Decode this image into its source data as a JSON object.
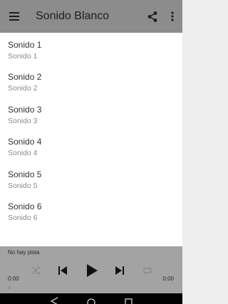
{
  "toolbar": {
    "title": "Sonido Blanco",
    "menu_icon": "hamburger-menu-icon",
    "share_icon": "share-icon",
    "overflow_icon": "more-vert-icon",
    "background": "#8c8c8c"
  },
  "list": {
    "items": [
      {
        "title": "Sonido 1",
        "subtitle": "Sonido 1"
      },
      {
        "title": "Sonido 2",
        "subtitle": "Sonido 2"
      },
      {
        "title": "Sonido 3",
        "subtitle": "Sonido 3"
      },
      {
        "title": "Sonido 4",
        "subtitle": "Sonido 4"
      },
      {
        "title": "Sonido 5",
        "subtitle": "Sonido 5"
      },
      {
        "title": "Sonido 6",
        "subtitle": "Sonido 6"
      }
    ]
  },
  "player": {
    "track_label": "No hay pista",
    "elapsed": "0:00",
    "duration": "0:00",
    "controls": {
      "shuffle_icon": "shuffle-icon",
      "previous_icon": "skip-previous-icon",
      "play_icon": "play-icon",
      "next_icon": "skip-next-icon",
      "repeat_icon": "repeat-icon"
    }
  },
  "navbar": {
    "back_icon": "back-icon",
    "home_icon": "home-icon",
    "recents_icon": "recents-icon"
  }
}
